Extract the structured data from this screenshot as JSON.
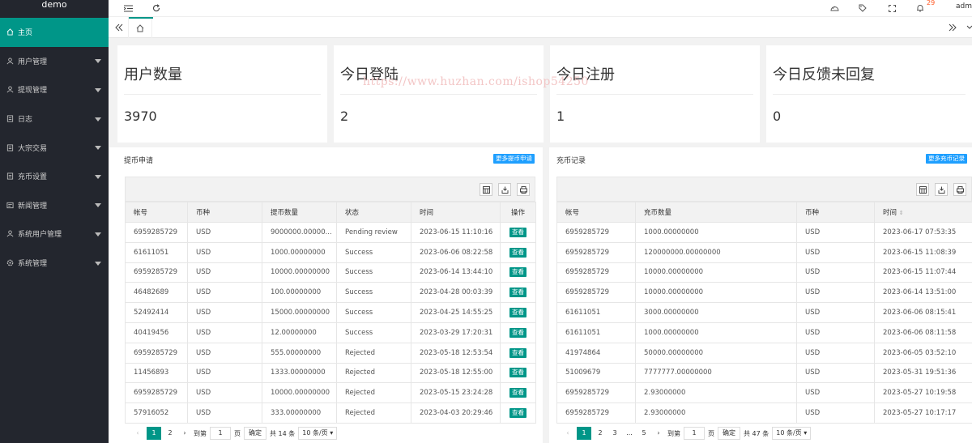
{
  "app": {
    "name": "demo",
    "user": "admin",
    "notif_count": "29"
  },
  "sidebar": {
    "items": [
      {
        "label": "主页"
      },
      {
        "label": "用户管理"
      },
      {
        "label": "提现管理"
      },
      {
        "label": "日志"
      },
      {
        "label": "大宗交易"
      },
      {
        "label": "充币设置"
      },
      {
        "label": "新闻管理"
      },
      {
        "label": "系统用户管理"
      },
      {
        "label": "系统管理"
      }
    ]
  },
  "stats": [
    {
      "title": "用户数量",
      "value": "3970"
    },
    {
      "title": "今日登陆",
      "value": "2"
    },
    {
      "title": "今日注册",
      "value": "1"
    },
    {
      "title": "今日反馈未回复",
      "value": "0"
    }
  ],
  "watermark": "https://www.huzhan.com/ishop54250",
  "withdraw": {
    "title": "提币申请",
    "more": "更多提币申请",
    "columns": [
      "帐号",
      "币种",
      "提币数量",
      "状态",
      "时间",
      "操作"
    ],
    "rows": [
      [
        "6959285729",
        "USD",
        "9000000.00000...",
        "Pending review",
        "2023-06-15 11:10:16",
        "查看"
      ],
      [
        "61611051",
        "USD",
        "1000.00000000",
        "Success",
        "2023-06-06 08:22:58",
        "查看"
      ],
      [
        "6959285729",
        "USD",
        "10000.00000000",
        "Success",
        "2023-06-14 13:44:10",
        "查看"
      ],
      [
        "46482689",
        "USD",
        "100.00000000",
        "Success",
        "2023-04-28 00:03:39",
        "查看"
      ],
      [
        "52492414",
        "USD",
        "15000.00000000",
        "Success",
        "2023-04-25 14:55:25",
        "查看"
      ],
      [
        "40419456",
        "USD",
        "12.00000000",
        "Success",
        "2023-03-29 17:20:31",
        "查看"
      ],
      [
        "6959285729",
        "USD",
        "555.00000000",
        "Rejected",
        "2023-05-18 12:53:54",
        "查看"
      ],
      [
        "11456893",
        "USD",
        "1333.00000000",
        "Rejected",
        "2023-05-18 12:55:00",
        "查看"
      ],
      [
        "6959285729",
        "USD",
        "10000.00000000",
        "Rejected",
        "2023-05-15 23:24:28",
        "查看"
      ],
      [
        "57916052",
        "USD",
        "333.00000000",
        "Rejected",
        "2023-04-03 20:29:46",
        "查看"
      ]
    ],
    "pager": {
      "pages": [
        "1",
        "2"
      ],
      "goto_label": "到第",
      "page_input": "1",
      "page_unit": "页",
      "confirm": "确定",
      "total": "共 14 条",
      "per_page": "10 条/页"
    }
  },
  "deposit": {
    "title": "充币记录",
    "more": "更多充币记录",
    "columns": [
      "帐号",
      "充币数量",
      "币种",
      "时间"
    ],
    "rows": [
      [
        "6959285729",
        "1000.00000000",
        "USD",
        "2023-06-17 07:53:35"
      ],
      [
        "6959285729",
        "120000000.00000000",
        "USD",
        "2023-06-15 11:08:39"
      ],
      [
        "6959285729",
        "10000.00000000",
        "USD",
        "2023-06-15 11:07:44"
      ],
      [
        "6959285729",
        "10000.00000000",
        "USD",
        "2023-06-14 13:51:00"
      ],
      [
        "61611051",
        "3000.00000000",
        "USD",
        "2023-06-06 08:15:41"
      ],
      [
        "61611051",
        "1000.00000000",
        "USD",
        "2023-06-06 08:11:58"
      ],
      [
        "41974864",
        "50000.00000000",
        "USD",
        "2023-06-05 03:52:10"
      ],
      [
        "51009679",
        "7777777.00000000",
        "USD",
        "2023-05-31 19:51:36"
      ],
      [
        "6959285729",
        "2.93000000",
        "USD",
        "2023-05-27 10:19:58"
      ],
      [
        "6959285729",
        "2.93000000",
        "USD",
        "2023-05-27 10:17:17"
      ]
    ],
    "pager": {
      "pages": [
        "1",
        "2",
        "3",
        "...",
        "5"
      ],
      "goto_label": "到第",
      "page_input": "1",
      "page_unit": "页",
      "confirm": "确定",
      "total": "共 47 条",
      "per_page": "10 条/页"
    }
  }
}
